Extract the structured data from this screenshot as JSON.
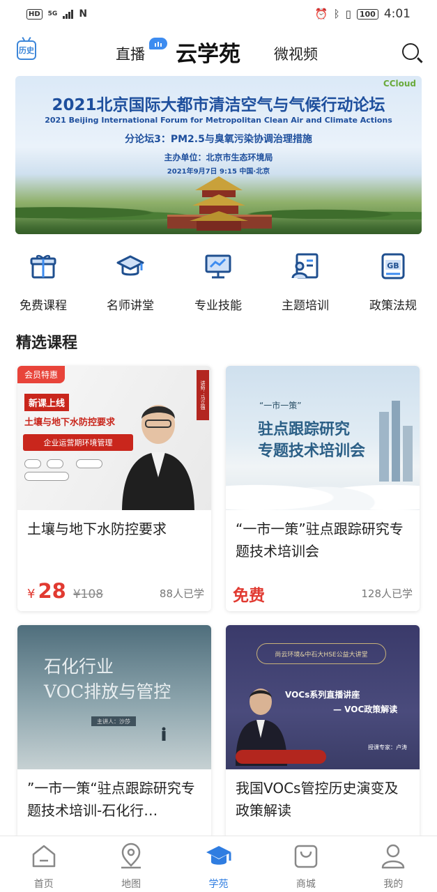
{
  "status_bar": {
    "hd": "HD",
    "signal": "5G",
    "nfc": "N",
    "battery": "100",
    "time": "4:01"
  },
  "header": {
    "history_icon_label": "历史",
    "tab_live": "直播",
    "tab_main": "云学苑",
    "tab_video": "微视频"
  },
  "banner": {
    "logo": "CCloud",
    "title": "2021北京国际大都市清洁空气与气候行动论坛",
    "title_en": "2021 Beijing International Forum for Metropolitan Clean Air and Climate Actions",
    "subtitle": "分论坛3：PM2.5与臭氧污染协调治理措施",
    "host": "主办单位：北京市生态环境局",
    "date": "2021年9月7日 9:15 中国·北京"
  },
  "categories": [
    {
      "label": "免费课程",
      "icon": "gift-icon"
    },
    {
      "label": "名师讲堂",
      "icon": "graduation-cap-icon"
    },
    {
      "label": "专业技能",
      "icon": "monitor-chart-icon"
    },
    {
      "label": "主题培训",
      "icon": "person-document-icon"
    },
    {
      "label": "政策法规",
      "icon": "gb-document-icon"
    }
  ],
  "section_title": "精选课程",
  "courses": [
    {
      "title": "土壤与地下水防控要求",
      "currency": "¥",
      "price": "28",
      "original_price": "¥108",
      "learners": "88人已学",
      "image": {
        "tag": "会员特惠",
        "new_label": "新课上线",
        "headline": "土壤与地下水防控要求",
        "bar": "企业运营期环境管理",
        "vertical": "讲师：马立强"
      }
    },
    {
      "title": "“一市一策”驻点跟踪研究专题技术培训会",
      "price_label": "免费",
      "learners": "128人已学",
      "image": {
        "small": "“一市一策”",
        "big_line1": "驻点跟踪研究",
        "big_line2": "专题技术培训会"
      }
    },
    {
      "title": "”一市一策“驻点跟踪研究专题技术培训-石化行…",
      "image": {
        "line1": "石化行业",
        "line2": "VOC排放与管控",
        "lecturer": "主讲人：沙莎"
      }
    },
    {
      "title": "我国VOCs管控历史演变及政策解读",
      "image": {
        "pill": "尚云环境&中石大HSE公益大讲堂",
        "line1": "VOCs系列直播讲座",
        "line2": "— VOC政策解读",
        "expert": "授课专家：卢涛"
      }
    }
  ],
  "bottom_nav": [
    {
      "label": "首页",
      "icon": "home-icon",
      "active": false
    },
    {
      "label": "地图",
      "icon": "map-pin-icon",
      "active": false
    },
    {
      "label": "学苑",
      "icon": "graduation-cap-icon",
      "active": true
    },
    {
      "label": "商城",
      "icon": "shopping-bag-icon",
      "active": false
    },
    {
      "label": "我的",
      "icon": "profile-icon",
      "active": false
    }
  ],
  "colors": {
    "accent": "#2f7de1",
    "price": "#e13a31",
    "banner_title": "#1e4f9d"
  }
}
